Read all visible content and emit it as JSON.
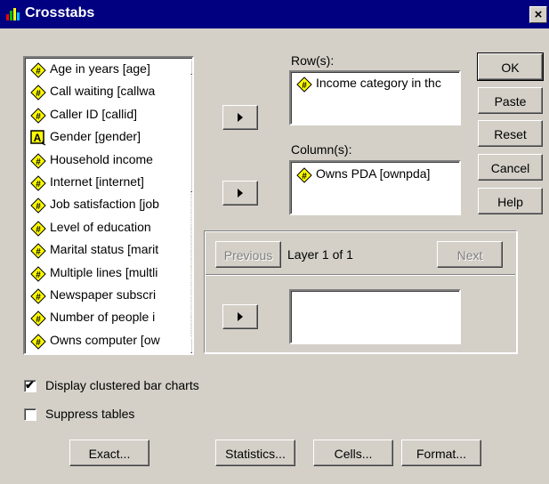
{
  "window": {
    "title": "Crosstabs",
    "close_label": "×"
  },
  "variables": [
    {
      "label": "Age in years [age]",
      "type": "numeric"
    },
    {
      "label": "Call waiting [callwa",
      "type": "numeric"
    },
    {
      "label": "Caller ID [callid]",
      "type": "numeric"
    },
    {
      "label": "Gender [gender]",
      "type": "string"
    },
    {
      "label": "Household income",
      "type": "numeric"
    },
    {
      "label": "Internet [internet]",
      "type": "numeric"
    },
    {
      "label": "Job satisfaction [job",
      "type": "numeric"
    },
    {
      "label": "Level of education",
      "type": "numeric"
    },
    {
      "label": "Marital status [marit",
      "type": "numeric"
    },
    {
      "label": "Multiple lines [multli",
      "type": "numeric"
    },
    {
      "label": "Newspaper subscri",
      "type": "numeric"
    },
    {
      "label": "Number of people i",
      "type": "numeric"
    },
    {
      "label": "Owns computer [ow",
      "type": "numeric"
    }
  ],
  "rows": {
    "label": "Row(s):",
    "item": "Income category in thc"
  },
  "columns": {
    "label": "Column(s):",
    "item": "Owns PDA [ownpda]"
  },
  "layer": {
    "previous": "Previous",
    "text": "Layer 1 of 1",
    "next": "Next"
  },
  "side_buttons": {
    "ok": "OK",
    "paste": "Paste",
    "reset": "Reset",
    "cancel": "Cancel",
    "help": "Help"
  },
  "options": {
    "clustered": {
      "label": "Display clustered bar charts",
      "checked": true
    },
    "suppress": {
      "label": "Suppress tables",
      "checked": false
    }
  },
  "bottom_buttons": {
    "exact": "Exact...",
    "statistics": "Statistics...",
    "cells": "Cells...",
    "format": "Format..."
  },
  "colors": {
    "title_bar": "#000080",
    "dialog": "#d4d0c8",
    "icon_fill": "#ffff00"
  }
}
